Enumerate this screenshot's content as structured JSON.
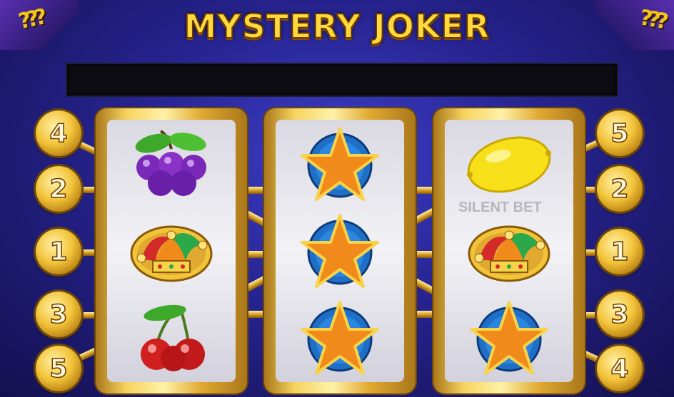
{
  "game": {
    "title": "MYSTERY JOKER",
    "corner_left": "???",
    "corner_right": "???",
    "message": "",
    "watermark": "SILENT BET"
  },
  "paylines": {
    "left": [
      "4",
      "2",
      "1",
      "3",
      "5"
    ],
    "right": [
      "5",
      "2",
      "1",
      "3",
      "4"
    ]
  },
  "reels": [
    {
      "symbols": [
        "grapes-icon",
        "joker-hat-icon",
        "cherries-icon"
      ]
    },
    {
      "symbols": [
        "star-icon",
        "star-icon",
        "star-icon"
      ]
    },
    {
      "symbols": [
        "lemon-icon",
        "joker-hat-icon",
        "star-icon"
      ]
    }
  ],
  "colors": {
    "background": "#26238f",
    "gold": "#f2c43a",
    "title": "#ffd93d",
    "star_orange": "#f08a1a",
    "star_badge_blue": "#1f6fc7"
  }
}
